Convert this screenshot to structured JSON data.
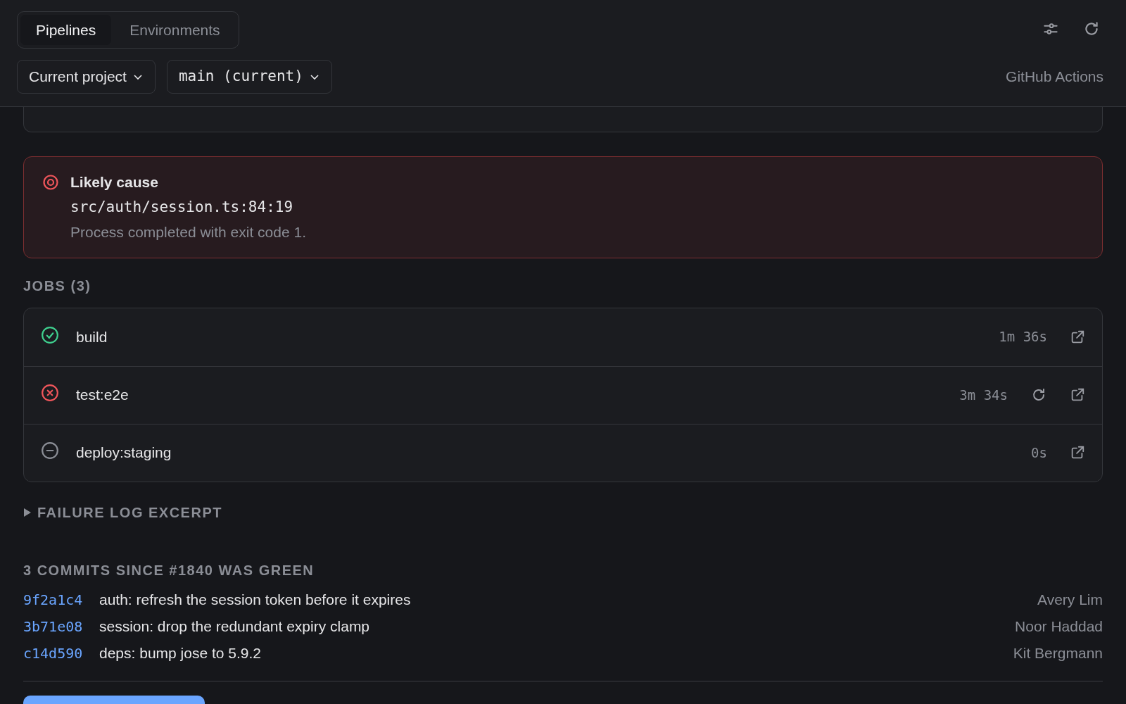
{
  "tabs": [
    {
      "label": "Pipelines",
      "selected": true
    },
    {
      "label": "Environments",
      "selected": false
    }
  ],
  "filters": [
    {
      "label": "Current project",
      "kind": "text"
    },
    {
      "label": "main (current)",
      "kind": "mono"
    }
  ],
  "source": "GitHub Actions",
  "likely_cause": {
    "title": "Likely cause",
    "location": "src/auth/session.ts:84:19",
    "message": "Process completed with exit code 1."
  },
  "jobs": {
    "heading": "JOBS (3)",
    "items": [
      {
        "name": "build",
        "kind": "success",
        "duration": "1m 36s",
        "retry": false
      },
      {
        "name": "test:e2e",
        "kind": "failure",
        "duration": "3m 34s",
        "retry": true
      },
      {
        "name": "deploy:staging",
        "kind": "skipped",
        "duration": "0s",
        "retry": false
      }
    ]
  },
  "failure_log": {
    "label": "FAILURE LOG EXCERPT",
    "expanded": false
  },
  "commits": {
    "heading": "3 COMMITS SINCE #1840 WAS GREEN",
    "items": [
      {
        "sha": "9f2a1c4",
        "message": "auth: refresh the session token before it expires",
        "author": "Avery Lim"
      },
      {
        "sha": "3b71e08",
        "message": "session: drop the redundant expiry clamp",
        "author": "Noor Haddad"
      },
      {
        "sha": "c14d590",
        "message": "deps: bump jose to 5.9.2",
        "author": "Kit Bergmann"
      }
    ]
  }
}
